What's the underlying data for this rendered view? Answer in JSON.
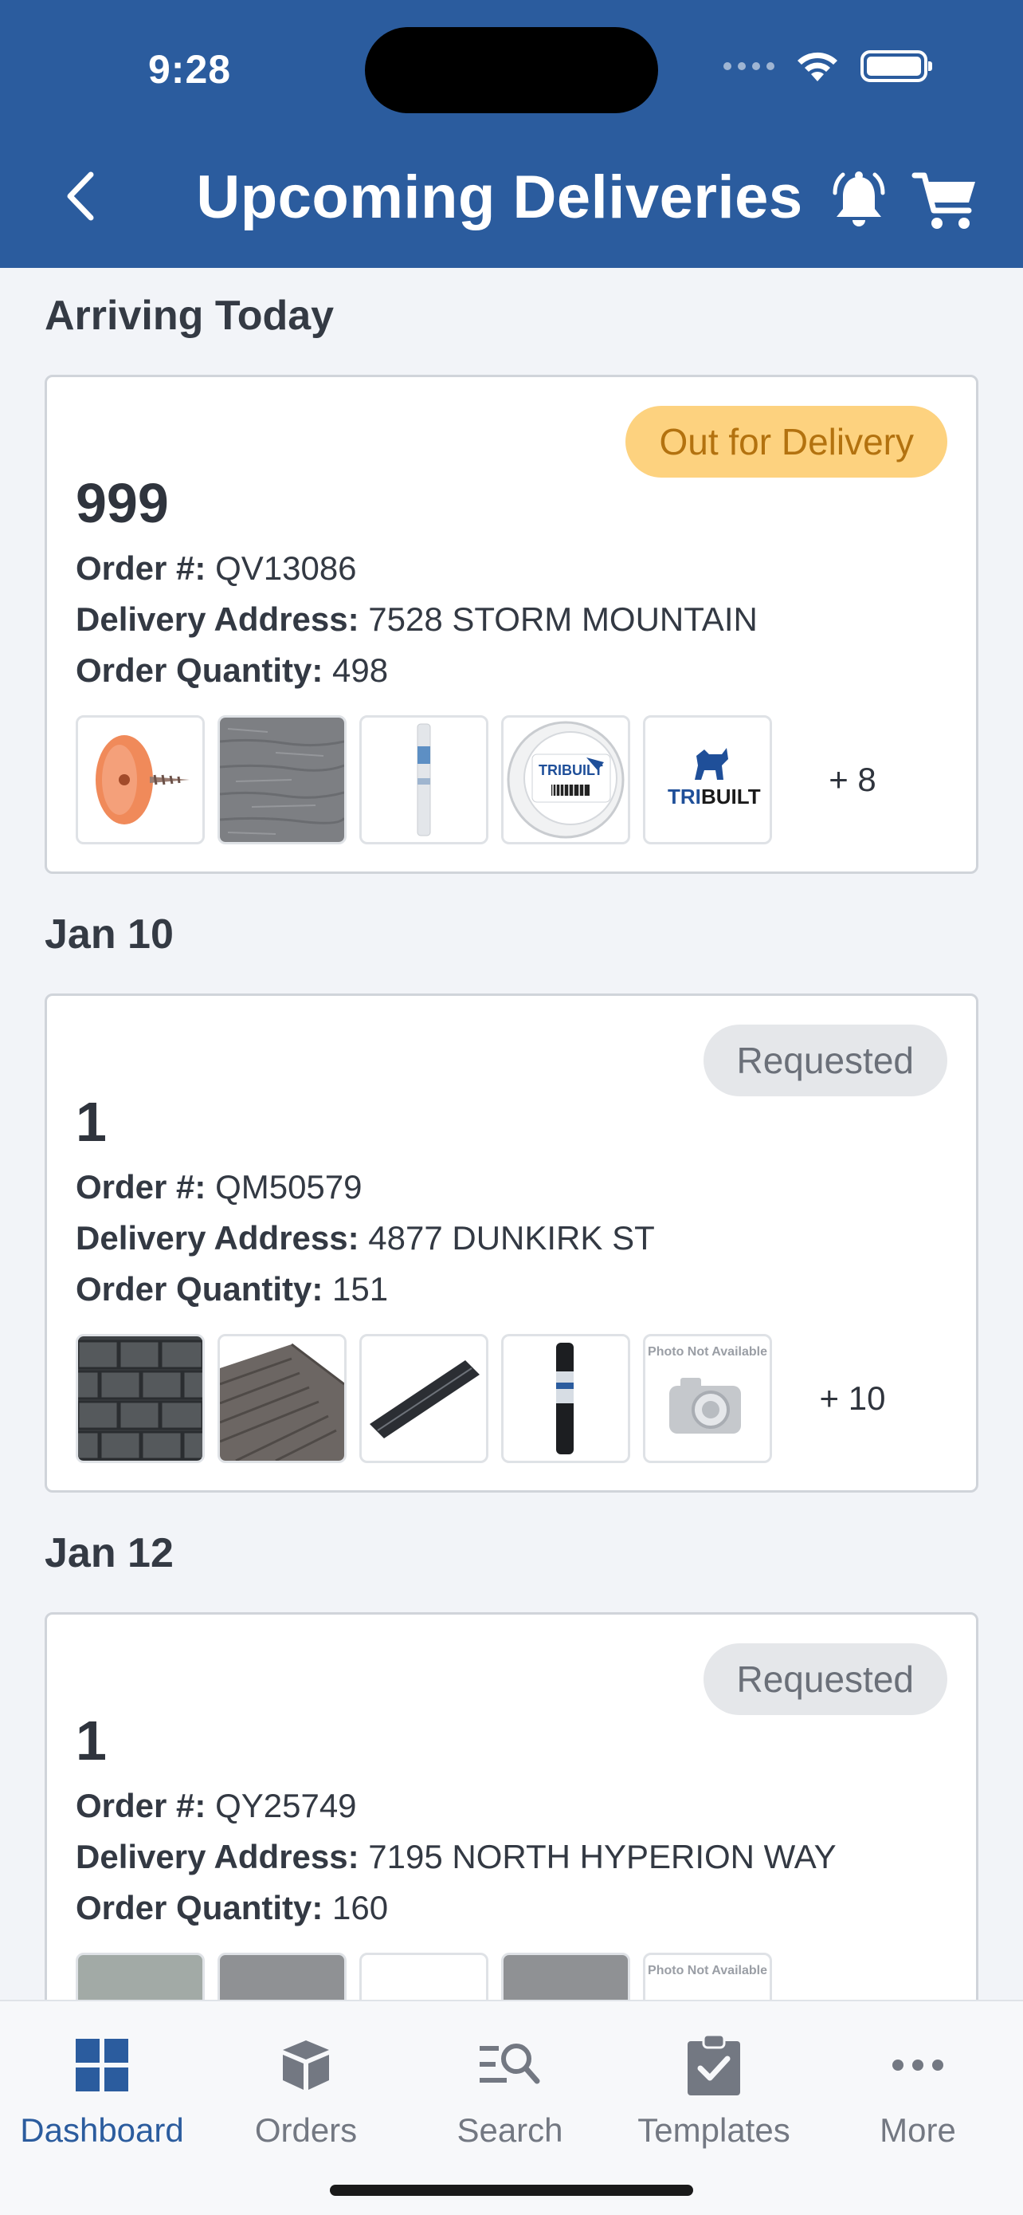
{
  "status_bar": {
    "time": "9:28"
  },
  "header": {
    "title": "Upcoming Deliveries"
  },
  "sections": [
    {
      "title": "Arriving Today",
      "card": {
        "status": "Out for Delivery",
        "name": "999",
        "order_label": "Order #:",
        "order_number": "QV13086",
        "address_label": "Delivery Address:",
        "address": "7528 STORM MOUNTAIN",
        "quantity_label": "Order Quantity:",
        "quantity": "498",
        "more": "+ 8",
        "thumbnails": [
          {
            "alt": "Orange cap nail",
            "brand": ""
          },
          {
            "alt": "Gray siding texture",
            "brand": ""
          },
          {
            "alt": "House wrap roll",
            "brand": ""
          },
          {
            "alt": "TriBuilt tape roll",
            "brand": "TRIBUILT"
          },
          {
            "alt": "TriBuilt logo",
            "brand": "TRIBUILT"
          }
        ]
      }
    },
    {
      "title": "Jan 10",
      "card": {
        "status": "Requested",
        "name": "1",
        "order_label": "Order #:",
        "order_number": "QM50579",
        "address_label": "Delivery Address:",
        "address": "4877 DUNKIRK ST",
        "quantity_label": "Order Quantity:",
        "quantity": "151",
        "more": "+ 10",
        "thumbnails": [
          {
            "alt": "Dark shingles",
            "brand": ""
          },
          {
            "alt": "Roof shingles",
            "brand": ""
          },
          {
            "alt": "Ridge vent strip",
            "brand": ""
          },
          {
            "alt": "Underlayment roll",
            "brand": ""
          },
          {
            "alt": "Photo Not Available",
            "brand": "Photo Not Available"
          }
        ]
      }
    },
    {
      "title": "Jan 12",
      "card": {
        "status": "Requested",
        "name": "1",
        "order_label": "Order #:",
        "order_number": "QY25749",
        "address_label": "Delivery Address:",
        "address": "7195 NORTH HYPERION WAY",
        "quantity_label": "Order Quantity:",
        "quantity": "160",
        "more": "",
        "thumbnails": [
          {
            "alt": "Green gray product",
            "brand": ""
          },
          {
            "alt": "Gray product",
            "brand": ""
          },
          {
            "alt": "White product",
            "brand": ""
          },
          {
            "alt": "Gray product",
            "brand": ""
          },
          {
            "alt": "Photo Not Available",
            "brand": "Photo Not Available"
          }
        ]
      }
    }
  ],
  "tabbar": {
    "items": [
      {
        "label": "Dashboard",
        "icon": "dashboard-grid-icon",
        "active": true
      },
      {
        "label": "Orders",
        "icon": "box-icon",
        "active": false
      },
      {
        "label": "Search",
        "icon": "search-list-icon",
        "active": false
      },
      {
        "label": "Templates",
        "icon": "clipboard-check-icon",
        "active": false
      },
      {
        "label": "More",
        "icon": "more-dots-icon",
        "active": false
      }
    ]
  },
  "colors": {
    "header_bg": "#2b5c9e",
    "accent": "#2b5c9e",
    "badge_out_bg": "#fdd27f",
    "badge_out_text": "#b3720f",
    "badge_requested_bg": "#e5e7ea"
  }
}
